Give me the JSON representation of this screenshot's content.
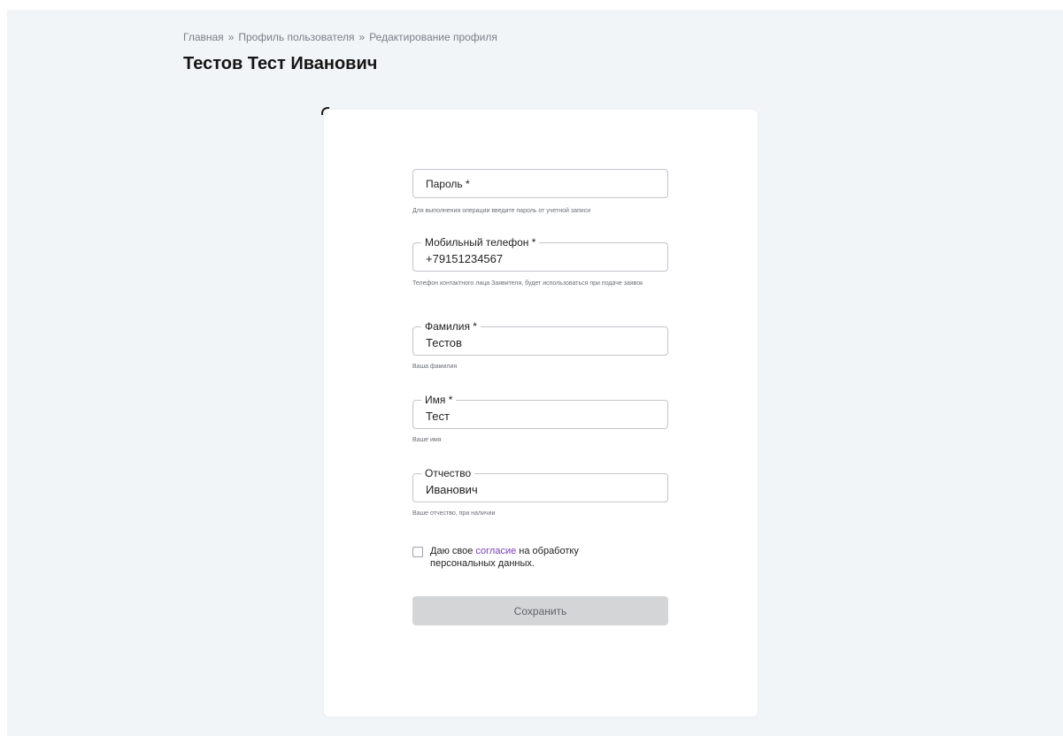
{
  "breadcrumb": {
    "items": [
      "Главная",
      "Профиль пользователя",
      "Редактирование профиля"
    ],
    "separator": "»"
  },
  "page": {
    "title": "Тестов Тест Иванович"
  },
  "form": {
    "password": {
      "placeholder": "Пароль *",
      "hint": "Для выполнения операции введите пароль от учетной записи"
    },
    "phone": {
      "label": "Мобильный телефон *",
      "value": "+79151234567",
      "hint": "Телефон контактного лица Заявителя, будет использоваться при подаче заявок"
    },
    "last_name": {
      "label": "Фамилия *",
      "value": "Тестов",
      "hint": "Ваша фамилия"
    },
    "first_name": {
      "label": "Имя *",
      "value": "Тест",
      "hint": "Ваше имя"
    },
    "middle_name": {
      "label": "Отчество",
      "value": "Иванович",
      "hint": "Ваше отчество, при наличии"
    },
    "consent": {
      "prefix": "Даю свое",
      "link": "согласие",
      "suffix": "на обработку персональных данных.",
      "checked": false
    },
    "save_label": "Сохранить"
  },
  "colors": {
    "page_background": "#f2f5f8",
    "link_accent": "#7a3db8",
    "button_disabled": "#d4d5d7"
  }
}
